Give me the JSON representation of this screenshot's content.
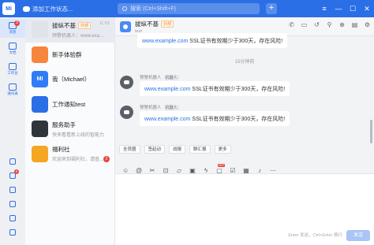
{
  "topbar": {
    "logo_text": "Mi",
    "status_text": "添加工作状态...",
    "search_placeholder": "搜索 (Ctrl+Shift+F)",
    "plus_label": "+",
    "window_controls": [
      "≡",
      "—",
      "☐",
      "✕"
    ]
  },
  "leftnav": {
    "items": [
      {
        "label": "消息",
        "icon": "chat-icon",
        "badge": "3",
        "active": true
      },
      {
        "label": "文档",
        "icon": "document-icon"
      },
      {
        "label": "工作台",
        "icon": "workbench-icon"
      },
      {
        "label": "通讯录",
        "icon": "contacts-icon"
      }
    ],
    "bottom_items": [
      {
        "icon": "calendar-icon",
        "badge": ""
      },
      {
        "icon": "mail-icon",
        "badge": "2"
      },
      {
        "icon": "lightning-icon",
        "badge": ""
      },
      {
        "icon": "task-icon",
        "badge": ""
      },
      {
        "icon": "link-icon",
        "badge": ""
      },
      {
        "icon": "more-icon",
        "badge": ""
      }
    ]
  },
  "conversations": [
    {
      "name": "拔纵不基",
      "tag": "外部",
      "preview": "预警机器人：www.exa...",
      "time": "11:01",
      "avatar_color": "#dfe3ea",
      "avatar_text": "",
      "active": true
    },
    {
      "name": "新手体验群",
      "tag": "",
      "preview": "",
      "time": "",
      "avatar_color": "#f5853f",
      "avatar_text": "",
      "active": false
    },
    {
      "name": "我（Michael）",
      "tag": "",
      "preview": "",
      "time": "",
      "avatar_color": "#2f7cf6",
      "avatar_text": "MI",
      "active": false
    },
    {
      "name": "工作通知test",
      "tag": "",
      "preview": "",
      "time": "",
      "avatar_color": "#2b6fe6",
      "avatar_text": "",
      "active": false
    },
    {
      "name": "服务助手",
      "tag": "",
      "preview": "快来看看新上线的智能力",
      "time": "",
      "avatar_color": "#30343b",
      "avatar_text": "",
      "active": false
    },
    {
      "name": "福利社",
      "tag": "",
      "preview": "欢迎来到福利社，请查...",
      "time": "",
      "avatar_color": "#f5a623",
      "avatar_text": "",
      "active": false,
      "badge": "2"
    }
  ],
  "chat": {
    "title": "拔纵不基",
    "title_tag": "外部",
    "subtitle": "test",
    "header_icons": [
      "phone-icon",
      "video-icon",
      "history-icon",
      "pin-icon",
      "add-member-icon",
      "folder-icon",
      "settings-icon"
    ],
    "top_bubble": {
      "link": "www.example.com",
      "text": " SSL证书有效期少于300天，存在风险!"
    },
    "time_separator": "15分钟前",
    "messages": [
      {
        "sender": "预警机器人",
        "tag": "机器人",
        "link": "www.example.com",
        "text": " SSL证书有效期少于300天，存在风险!"
      },
      {
        "sender": "预警机器人",
        "tag": "机器人",
        "link": "www.example.com",
        "text": " SSL证书有效期少于300天，存在风险!"
      }
    ],
    "quick_buttons": [
      "全员圈",
      "签起动",
      "战报",
      "聊汇报",
      "更多"
    ],
    "toolbar_icons": [
      "emoji-icon",
      "at-icon",
      "scissors-icon",
      "screenshot-icon",
      "folder-icon",
      "image-icon",
      "lightning-icon",
      "hot-icon",
      "task-icon",
      "calendar-icon",
      "mic-icon",
      "more-icon"
    ],
    "hot_badge": "HOT",
    "send_hint": "Enter 发送，Ctrl+Enter 换行",
    "send_label": "发送"
  }
}
